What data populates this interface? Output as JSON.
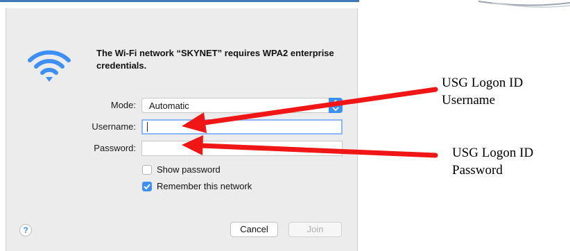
{
  "dialog": {
    "message": "The Wi-Fi network “SKYNET” requires WPA2 enterprise credentials.",
    "mode": {
      "label": "Mode:",
      "value": "Automatic"
    },
    "username": {
      "label": "Username:",
      "value": ""
    },
    "password": {
      "label": "Password:",
      "value": ""
    },
    "show_password": {
      "label": "Show password",
      "checked": false
    },
    "remember_network": {
      "label": "Remember this network",
      "checked": true
    },
    "help_label": "?",
    "cancel_label": "Cancel",
    "join_label": "Join"
  },
  "annotations": {
    "username_note": {
      "line1": "USG Logon ID",
      "line2": "Username"
    },
    "password_note": {
      "line1": "USG Logon ID",
      "line2": "Password"
    }
  },
  "colors": {
    "accent": "#3d8ff5",
    "arrow": "#f01616",
    "dialog_bg": "#ececec"
  },
  "icons": {
    "network": "wifi-icon",
    "help": "help-icon",
    "select": "chevron-updown-icon",
    "check": "checkmark-icon"
  }
}
